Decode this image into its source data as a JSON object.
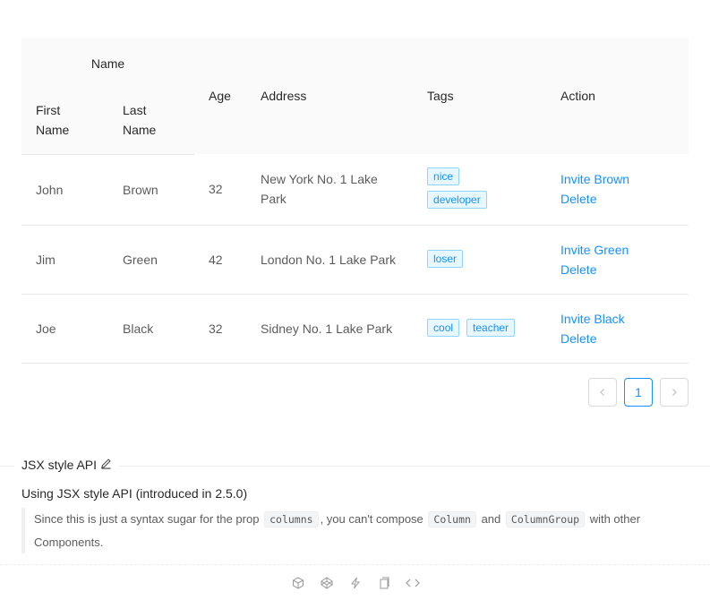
{
  "table": {
    "header": {
      "group": "Name",
      "first_name": "First\nName",
      "last_name": "Last\nName",
      "age": "Age",
      "address": "Address",
      "tags": "Tags",
      "action": "Action"
    },
    "rows": [
      {
        "first": "John",
        "last": "Brown",
        "age": "32",
        "address": "New York No. 1 Lake Park",
        "tags": [
          "nice",
          "developer"
        ],
        "invite": "Invite Brown",
        "delete": "Delete"
      },
      {
        "first": "Jim",
        "last": "Green",
        "age": "42",
        "address": "London No. 1 Lake Park",
        "tags": [
          "loser"
        ],
        "invite": "Invite Green",
        "delete": "Delete"
      },
      {
        "first": "Joe",
        "last": "Black",
        "age": "32",
        "address": "Sidney No. 1 Lake Park",
        "tags": [
          "cool",
          "teacher"
        ],
        "invite": "Invite Black",
        "delete": "Delete"
      }
    ]
  },
  "pagination": {
    "prev": "‹",
    "current": "1",
    "next": "›"
  },
  "demo": {
    "title": "JSX style API",
    "heading": "Using JSX style API (introduced in 2.5.0)",
    "text1": "Since this is just a syntax sugar for the prop",
    "code1": "columns",
    "text2": ", you can't compose",
    "code2": "Column",
    "text3": "and",
    "code3": "ColumnGroup",
    "text4": "with other Components."
  },
  "footer_icons": [
    "codesandbox-icon",
    "codepen-icon",
    "thunderbolt-icon",
    "copy-icon",
    "code-icon"
  ],
  "colors": {
    "accent": "#1890ff",
    "tag_bg": "#e6f7ff",
    "tag_border": "#91d5ff",
    "header_bg": "#fafafa"
  }
}
